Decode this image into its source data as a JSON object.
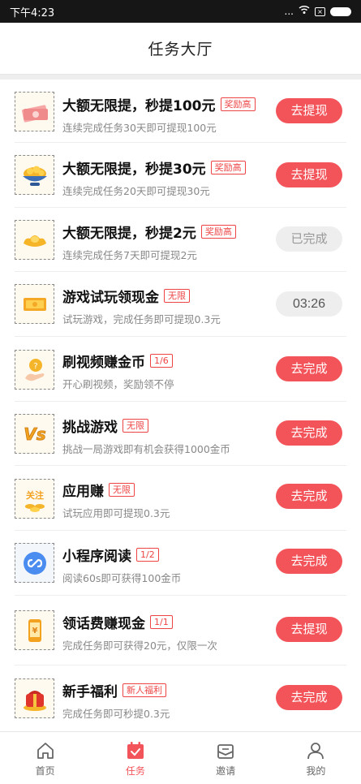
{
  "status_bar": {
    "time": "下午4:23",
    "dots": "...",
    "sim_icon": "sim-x-icon",
    "wifi_icon": "wifi-icon",
    "battery_icon": "battery-icon"
  },
  "header": {
    "title": "任务大厅"
  },
  "tasks": [
    {
      "icon": "money-stack-icon",
      "title": "大额无限提，秒提100元",
      "tag": "奖励高",
      "desc": "连续完成任务30天即可提现100元",
      "action": "去提现",
      "state": "active"
    },
    {
      "icon": "gold-bowl-icon",
      "title": "大额无限提，秒提30元",
      "tag": "奖励高",
      "desc": "连续完成任务20天即可提现30元",
      "action": "去提现",
      "state": "active"
    },
    {
      "icon": "gold-ingot-icon",
      "title": "大额无限提，秒提2元",
      "tag": "奖励高",
      "desc": "连续完成任务7天即可提现2元",
      "action": "已完成",
      "state": "done"
    },
    {
      "icon": "cash-bill-icon",
      "title": "游戏试玩领现金",
      "tag": "无限",
      "desc": "试玩游戏，完成任务即可提现0.3元",
      "action": "03:26",
      "state": "timer"
    },
    {
      "icon": "coin-hand-icon",
      "title": "刷视频赚金币",
      "tag": "1/6",
      "desc": "开心刷视频，奖励领不停",
      "action": "去完成",
      "state": "active"
    },
    {
      "icon": "vs-badge-icon",
      "title": "挑战游戏",
      "tag": "无限",
      "desc": "挑战一局游戏即有机会获得1000金币",
      "action": "去完成",
      "state": "active"
    },
    {
      "icon": "follow-coins-icon",
      "title": "应用赚",
      "tag": "无限",
      "desc": "试玩应用即可提现0.3元",
      "action": "去完成",
      "state": "active"
    },
    {
      "icon": "mini-program-icon",
      "title": "小程序阅读",
      "tag": "1/2",
      "desc": "阅读60s即可获得100金币",
      "action": "去完成",
      "state": "active"
    },
    {
      "icon": "phone-bill-icon",
      "title": "领话费赚现金",
      "tag": "1/1",
      "desc": "完成任务即可获得20元，仅限一次",
      "action": "去提现",
      "state": "active"
    },
    {
      "icon": "gift-box-icon",
      "title": "新手福利",
      "tag": "新人福利",
      "desc": "完成任务即可秒提0.3元",
      "action": "去完成",
      "state": "active"
    }
  ],
  "tab_bar": {
    "items": [
      {
        "label": "首页",
        "icon": "home-icon"
      },
      {
        "label": "任务",
        "icon": "task-calendar-icon",
        "active": true
      },
      {
        "label": "邀请",
        "icon": "invite-envelope-icon"
      },
      {
        "label": "我的",
        "icon": "profile-icon"
      }
    ]
  },
  "colors": {
    "accent": "#f3545a",
    "tag": "#ee4444",
    "done_bg": "#eeeeee"
  }
}
